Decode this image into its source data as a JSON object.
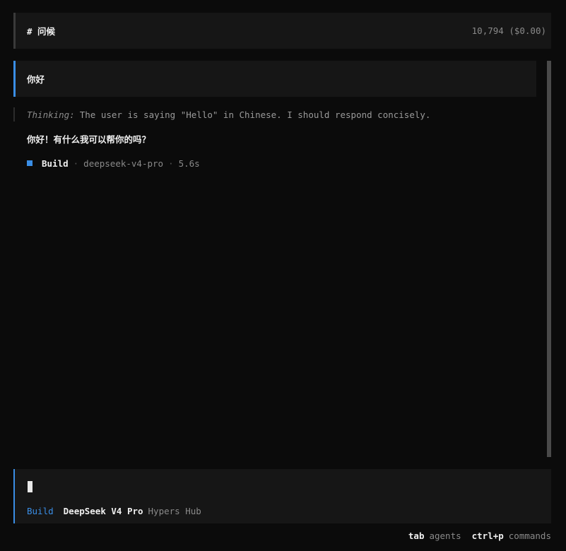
{
  "header": {
    "title": "# 问候",
    "cost": "10,794 ($0.00)"
  },
  "conversation": {
    "user_message": "你好",
    "thinking_label": "Thinking:",
    "thinking_text": "The user is saying \"Hello\" in Chinese. I should respond concisely.",
    "assistant_reply": "你好！有什么我可以帮你的吗？",
    "build": {
      "agent": "Build",
      "separator": "·",
      "model": "deepseek-v4-pro",
      "duration": "5.6s"
    }
  },
  "input": {
    "agent": "Build",
    "model": "DeepSeek V4 Pro",
    "provider": "Hypers Hub"
  },
  "footer": {
    "shortcuts": [
      {
        "key": "tab",
        "desc": "agents"
      },
      {
        "key": "ctrl+p",
        "desc": "commands"
      }
    ]
  },
  "colors": {
    "accent": "#3a8ee6",
    "background": "#0b0b0b",
    "panel": "#161616"
  }
}
